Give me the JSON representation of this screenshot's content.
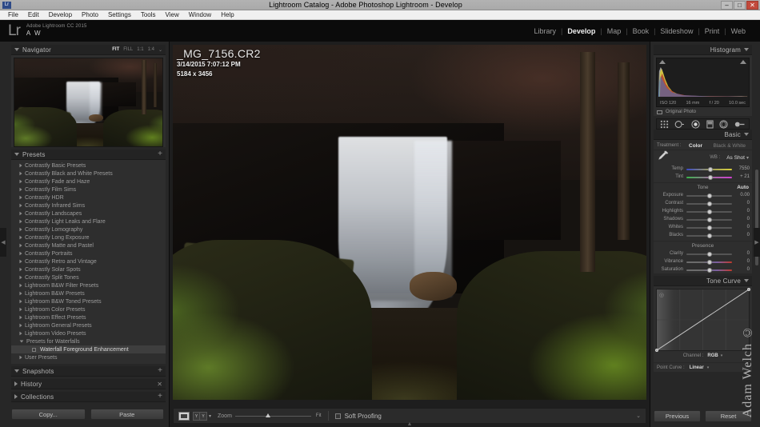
{
  "window": {
    "title": "Lightroom Catalog - Adobe Photoshop Lightroom - Develop",
    "app_icon": "Lr",
    "minimize": "–",
    "maximize": "□",
    "close": "✕"
  },
  "menubar": {
    "items": [
      "File",
      "Edit",
      "Develop",
      "Photo",
      "Settings",
      "Tools",
      "View",
      "Window",
      "Help"
    ]
  },
  "identity": {
    "logo": "Lr",
    "app_name": "Adobe Lightroom CC 2015",
    "user_initials": "A W"
  },
  "modules": {
    "items": [
      {
        "label": "Library",
        "active": false
      },
      {
        "label": "Develop",
        "active": true
      },
      {
        "label": "Map",
        "active": false
      },
      {
        "label": "Book",
        "active": false
      },
      {
        "label": "Slideshow",
        "active": false
      },
      {
        "label": "Print",
        "active": false
      },
      {
        "label": "Web",
        "active": false
      }
    ],
    "separator": "|"
  },
  "navigator": {
    "title": "Navigator",
    "modes": [
      {
        "label": "FIT",
        "active": true
      },
      {
        "label": "FILL",
        "active": false
      },
      {
        "label": "1:1",
        "active": false
      },
      {
        "label": "1:4",
        "active": false
      }
    ],
    "mode_caret": "⌄"
  },
  "presets": {
    "title": "Presets",
    "add_label": "+",
    "items": [
      {
        "label": "Contrastly Basic Presets",
        "expanded": false,
        "child": false,
        "selected": false
      },
      {
        "label": "Contrastly Black and White Presets",
        "expanded": false,
        "child": false,
        "selected": false
      },
      {
        "label": "Contrastly Fade and Haze",
        "expanded": false,
        "child": false,
        "selected": false
      },
      {
        "label": "Contrastly Film Sims",
        "expanded": false,
        "child": false,
        "selected": false
      },
      {
        "label": "Contrastly HDR",
        "expanded": false,
        "child": false,
        "selected": false
      },
      {
        "label": "Contrastly Infrared Sims",
        "expanded": false,
        "child": false,
        "selected": false
      },
      {
        "label": "Contrastly Landscapes",
        "expanded": false,
        "child": false,
        "selected": false
      },
      {
        "label": "Contrastly Light Leaks and Flare",
        "expanded": false,
        "child": false,
        "selected": false
      },
      {
        "label": "Contrastly Lomography",
        "expanded": false,
        "child": false,
        "selected": false
      },
      {
        "label": "Contrastly Long Exposure",
        "expanded": false,
        "child": false,
        "selected": false
      },
      {
        "label": "Contrastly Matte and Pastel",
        "expanded": false,
        "child": false,
        "selected": false
      },
      {
        "label": "Contrastly Portraits",
        "expanded": false,
        "child": false,
        "selected": false
      },
      {
        "label": "Contrastly Retro and Vintage",
        "expanded": false,
        "child": false,
        "selected": false
      },
      {
        "label": "Contrastly Solar Spots",
        "expanded": false,
        "child": false,
        "selected": false
      },
      {
        "label": "Contrastly Split Tones",
        "expanded": false,
        "child": false,
        "selected": false
      },
      {
        "label": "Lightroom B&W Filter Presets",
        "expanded": false,
        "child": false,
        "selected": false
      },
      {
        "label": "Lightroom B&W Presets",
        "expanded": false,
        "child": false,
        "selected": false
      },
      {
        "label": "Lightroom B&W Toned Presets",
        "expanded": false,
        "child": false,
        "selected": false
      },
      {
        "label": "Lightroom Color Presets",
        "expanded": false,
        "child": false,
        "selected": false
      },
      {
        "label": "Lightroom Effect Presets",
        "expanded": false,
        "child": false,
        "selected": false
      },
      {
        "label": "Lightroom General Presets",
        "expanded": false,
        "child": false,
        "selected": false
      },
      {
        "label": "Lightroom Video Presets",
        "expanded": false,
        "child": false,
        "selected": false
      },
      {
        "label": "Presets for Waterfalls",
        "expanded": true,
        "child": false,
        "selected": false
      },
      {
        "label": "Waterfall Foreground Enhancement",
        "expanded": false,
        "child": true,
        "selected": true
      },
      {
        "label": "User Presets",
        "expanded": false,
        "child": false,
        "selected": false
      }
    ]
  },
  "snapshots": {
    "title": "Snapshots",
    "add_label": "+"
  },
  "history": {
    "title": "History",
    "clear_label": "✕"
  },
  "collections": {
    "title": "Collections",
    "add_label": "+"
  },
  "left_buttons": {
    "copy": "Copy...",
    "paste": "Paste"
  },
  "photo": {
    "filename": "_MG_7156.CR2",
    "capture_date": "3/14/2015 7:07:12 PM",
    "dimensions": "5184 x 3456"
  },
  "toolbar": {
    "zoom_label": "Zoom",
    "zoom_value": "Fit",
    "soft_proofing_label": "Soft Proofing",
    "soft_proofing_checked": false,
    "caret": "⌄",
    "compare_labels": [
      "Y",
      "Y"
    ]
  },
  "histogram": {
    "title": "Histogram",
    "caret": "⌄",
    "exif": {
      "iso": "ISO 120",
      "focal_length": "16 mm",
      "aperture": "f / 20",
      "shutter": "10.0 sec"
    },
    "original_photo_label": "Original Photo"
  },
  "tools": {
    "items": [
      "crop-tool",
      "spot-removal-tool",
      "red-eye-tool",
      "graduated-filter-tool",
      "radial-filter-tool",
      "adjustment-brush-tool"
    ]
  },
  "basic": {
    "title": "Basic",
    "caret": "⌄",
    "treatment_label": "Treatment :",
    "treatment_options": [
      {
        "label": "Color",
        "active": true
      },
      {
        "label": "Black & White",
        "active": false
      }
    ],
    "wb_label": "WB :",
    "wb_value": "As Shot",
    "wb_caret": "⌄",
    "white_balance": [
      {
        "name": "Temp",
        "value": "7550",
        "pos": 52
      },
      {
        "name": "Tint",
        "value": "+ 21",
        "pos": 53
      }
    ],
    "tone_title": "Tone",
    "auto_label": "Auto",
    "tone": [
      {
        "name": "Exposure",
        "value": "0.00",
        "pos": 50
      },
      {
        "name": "Contrast",
        "value": "0",
        "pos": 50
      },
      {
        "name": "Highlights",
        "value": "0",
        "pos": 50
      },
      {
        "name": "Shadows",
        "value": "0",
        "pos": 50
      },
      {
        "name": "Whites",
        "value": "0",
        "pos": 50
      },
      {
        "name": "Blacks",
        "value": "0",
        "pos": 50
      }
    ],
    "presence_title": "Presence",
    "presence": [
      {
        "name": "Clarity",
        "value": "0",
        "pos": 50
      },
      {
        "name": "Vibrance",
        "value": "0",
        "pos": 50
      },
      {
        "name": "Saturation",
        "value": "0",
        "pos": 50
      }
    ]
  },
  "tone_curve": {
    "title": "Tone Curve",
    "caret": "⌄",
    "channel_label": "Channel :",
    "channel_value": "RGB",
    "channel_caret": "⌄",
    "point_curve_label": "Point Curve :",
    "point_curve_value": "Linear",
    "point_curve_caret": "⌄",
    "target_icon": "◎"
  },
  "right_buttons": {
    "previous": "Previous",
    "reset": "Reset"
  },
  "watermark": {
    "text": "Adam Welch ©"
  },
  "colors": {
    "panel_bg": "#272727",
    "panel_inner": "#2e2e2e",
    "accent_text": "#e6e6e6",
    "muted_text": "#9a9a9a",
    "chrome_dark": "#0b0b0b"
  }
}
